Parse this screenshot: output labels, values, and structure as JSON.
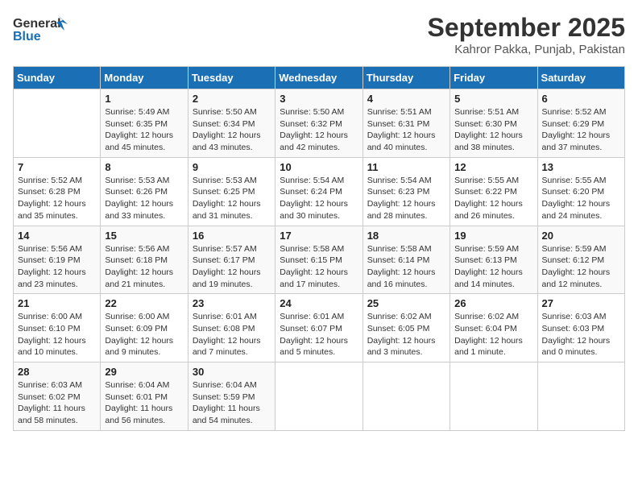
{
  "header": {
    "logo_line1": "General",
    "logo_line2": "Blue",
    "month_title": "September 2025",
    "subtitle": "Kahror Pakka, Punjab, Pakistan"
  },
  "days_of_week": [
    "Sunday",
    "Monday",
    "Tuesday",
    "Wednesday",
    "Thursday",
    "Friday",
    "Saturday"
  ],
  "weeks": [
    [
      {
        "day": "",
        "info": ""
      },
      {
        "day": "1",
        "info": "Sunrise: 5:49 AM\nSunset: 6:35 PM\nDaylight: 12 hours\nand 45 minutes."
      },
      {
        "day": "2",
        "info": "Sunrise: 5:50 AM\nSunset: 6:34 PM\nDaylight: 12 hours\nand 43 minutes."
      },
      {
        "day": "3",
        "info": "Sunrise: 5:50 AM\nSunset: 6:32 PM\nDaylight: 12 hours\nand 42 minutes."
      },
      {
        "day": "4",
        "info": "Sunrise: 5:51 AM\nSunset: 6:31 PM\nDaylight: 12 hours\nand 40 minutes."
      },
      {
        "day": "5",
        "info": "Sunrise: 5:51 AM\nSunset: 6:30 PM\nDaylight: 12 hours\nand 38 minutes."
      },
      {
        "day": "6",
        "info": "Sunrise: 5:52 AM\nSunset: 6:29 PM\nDaylight: 12 hours\nand 37 minutes."
      }
    ],
    [
      {
        "day": "7",
        "info": "Sunrise: 5:52 AM\nSunset: 6:28 PM\nDaylight: 12 hours\nand 35 minutes."
      },
      {
        "day": "8",
        "info": "Sunrise: 5:53 AM\nSunset: 6:26 PM\nDaylight: 12 hours\nand 33 minutes."
      },
      {
        "day": "9",
        "info": "Sunrise: 5:53 AM\nSunset: 6:25 PM\nDaylight: 12 hours\nand 31 minutes."
      },
      {
        "day": "10",
        "info": "Sunrise: 5:54 AM\nSunset: 6:24 PM\nDaylight: 12 hours\nand 30 minutes."
      },
      {
        "day": "11",
        "info": "Sunrise: 5:54 AM\nSunset: 6:23 PM\nDaylight: 12 hours\nand 28 minutes."
      },
      {
        "day": "12",
        "info": "Sunrise: 5:55 AM\nSunset: 6:22 PM\nDaylight: 12 hours\nand 26 minutes."
      },
      {
        "day": "13",
        "info": "Sunrise: 5:55 AM\nSunset: 6:20 PM\nDaylight: 12 hours\nand 24 minutes."
      }
    ],
    [
      {
        "day": "14",
        "info": "Sunrise: 5:56 AM\nSunset: 6:19 PM\nDaylight: 12 hours\nand 23 minutes."
      },
      {
        "day": "15",
        "info": "Sunrise: 5:56 AM\nSunset: 6:18 PM\nDaylight: 12 hours\nand 21 minutes."
      },
      {
        "day": "16",
        "info": "Sunrise: 5:57 AM\nSunset: 6:17 PM\nDaylight: 12 hours\nand 19 minutes."
      },
      {
        "day": "17",
        "info": "Sunrise: 5:58 AM\nSunset: 6:15 PM\nDaylight: 12 hours\nand 17 minutes."
      },
      {
        "day": "18",
        "info": "Sunrise: 5:58 AM\nSunset: 6:14 PM\nDaylight: 12 hours\nand 16 minutes."
      },
      {
        "day": "19",
        "info": "Sunrise: 5:59 AM\nSunset: 6:13 PM\nDaylight: 12 hours\nand 14 minutes."
      },
      {
        "day": "20",
        "info": "Sunrise: 5:59 AM\nSunset: 6:12 PM\nDaylight: 12 hours\nand 12 minutes."
      }
    ],
    [
      {
        "day": "21",
        "info": "Sunrise: 6:00 AM\nSunset: 6:10 PM\nDaylight: 12 hours\nand 10 minutes."
      },
      {
        "day": "22",
        "info": "Sunrise: 6:00 AM\nSunset: 6:09 PM\nDaylight: 12 hours\nand 9 minutes."
      },
      {
        "day": "23",
        "info": "Sunrise: 6:01 AM\nSunset: 6:08 PM\nDaylight: 12 hours\nand 7 minutes."
      },
      {
        "day": "24",
        "info": "Sunrise: 6:01 AM\nSunset: 6:07 PM\nDaylight: 12 hours\nand 5 minutes."
      },
      {
        "day": "25",
        "info": "Sunrise: 6:02 AM\nSunset: 6:05 PM\nDaylight: 12 hours\nand 3 minutes."
      },
      {
        "day": "26",
        "info": "Sunrise: 6:02 AM\nSunset: 6:04 PM\nDaylight: 12 hours\nand 1 minute."
      },
      {
        "day": "27",
        "info": "Sunrise: 6:03 AM\nSunset: 6:03 PM\nDaylight: 12 hours\nand 0 minutes."
      }
    ],
    [
      {
        "day": "28",
        "info": "Sunrise: 6:03 AM\nSunset: 6:02 PM\nDaylight: 11 hours\nand 58 minutes."
      },
      {
        "day": "29",
        "info": "Sunrise: 6:04 AM\nSunset: 6:01 PM\nDaylight: 11 hours\nand 56 minutes."
      },
      {
        "day": "30",
        "info": "Sunrise: 6:04 AM\nSunset: 5:59 PM\nDaylight: 11 hours\nand 54 minutes."
      },
      {
        "day": "",
        "info": ""
      },
      {
        "day": "",
        "info": ""
      },
      {
        "day": "",
        "info": ""
      },
      {
        "day": "",
        "info": ""
      }
    ]
  ]
}
